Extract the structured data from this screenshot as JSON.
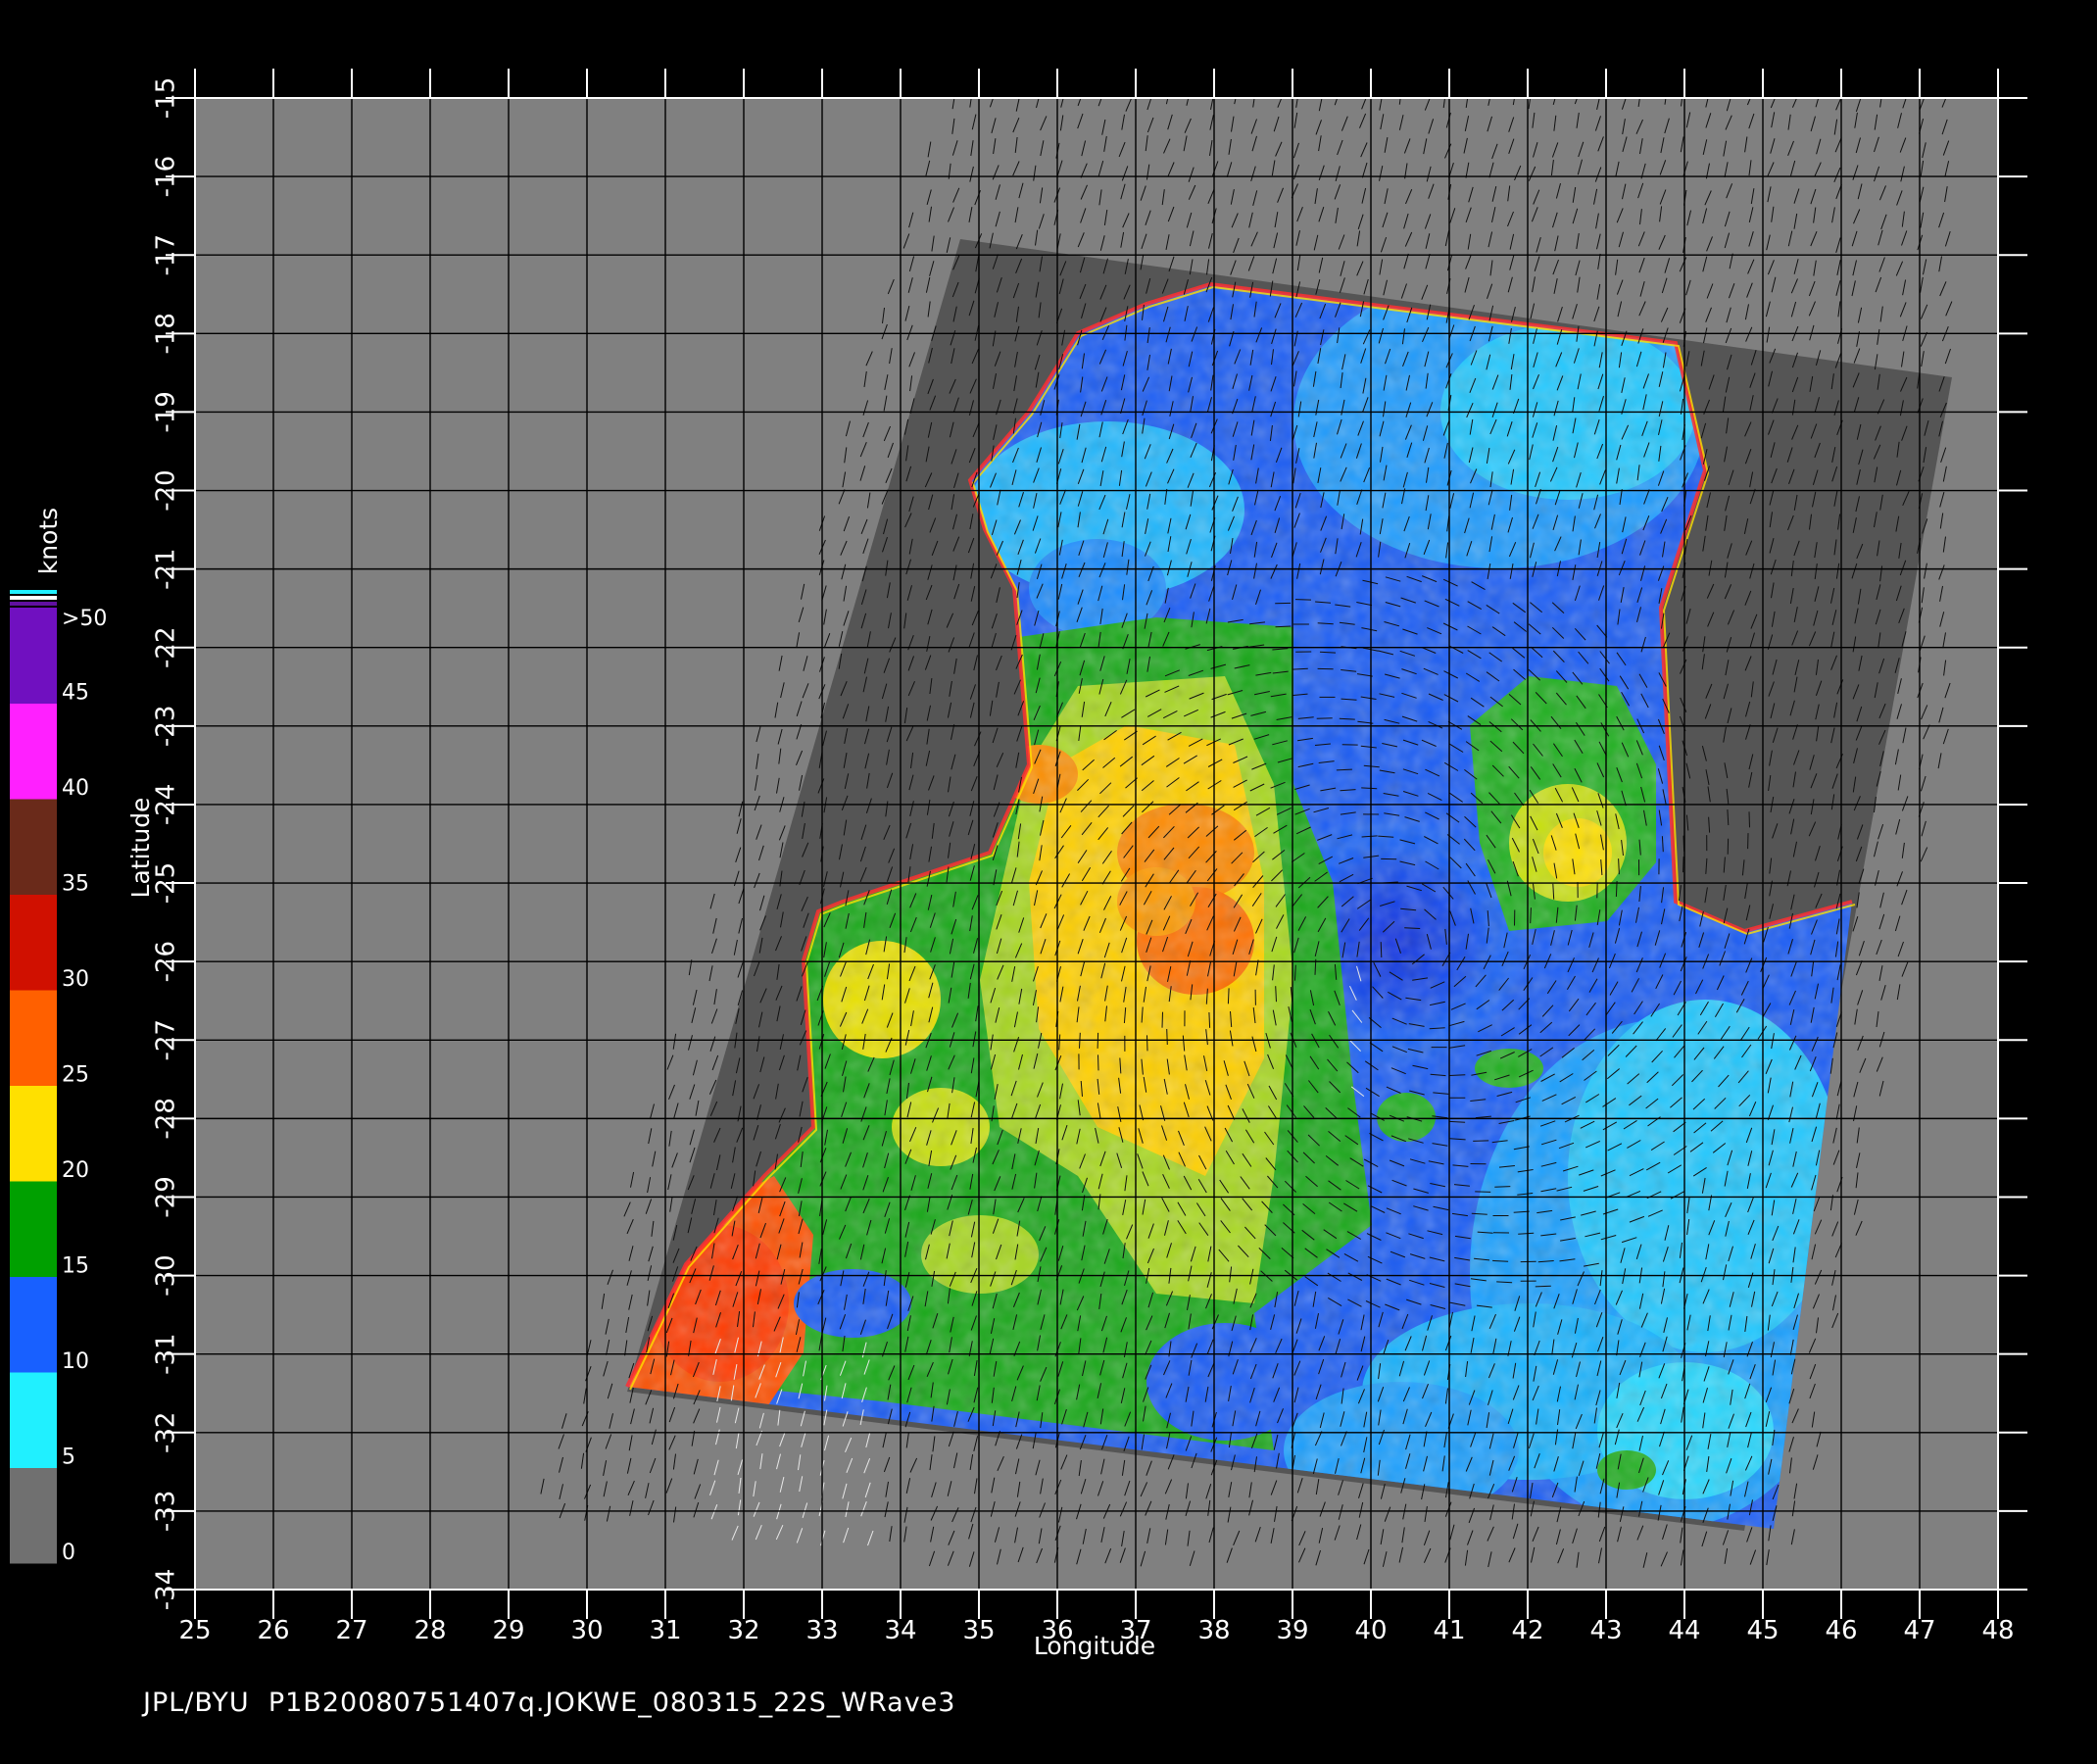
{
  "map": {
    "xlabel": "Longitude",
    "ylabel": "Latitude",
    "lon_range": [
      25,
      48
    ],
    "lat_range": [
      -34,
      -15
    ],
    "lon_ticks": [
      "25",
      "26",
      "27",
      "28",
      "29",
      "30",
      "31",
      "32",
      "33",
      "34",
      "35",
      "36",
      "37",
      "38",
      "39",
      "40",
      "41",
      "42",
      "43",
      "44",
      "45",
      "46",
      "47",
      "48"
    ],
    "lat_ticks": [
      "-15",
      "-16",
      "-17",
      "-18",
      "-19",
      "-20",
      "-21",
      "-22",
      "-23",
      "-24",
      "-25",
      "-26",
      "-27",
      "-28",
      "-29",
      "-30",
      "-31",
      "-32",
      "-33",
      "-34"
    ],
    "grid": true,
    "background_color": "#808080",
    "swath_color": "#555555",
    "storm_center_lon": 40.5,
    "storm_center_lat": -25.8
  },
  "colorbar": {
    "title": "knots",
    "labels": [
      "0",
      "5",
      "10",
      "15",
      "20",
      "25",
      "30",
      "35",
      "40",
      "45",
      ">50"
    ],
    "colors": [
      "#707070",
      "#20f0ff",
      "#1860ff",
      "#00a000",
      "#ffe000",
      "#ff6000",
      "#d01000",
      "#6a2a1a",
      "#ff20ff",
      "#7010c0"
    ]
  },
  "footer_text": "JPL/BYU  P1B20080751407q.JOKWE_080315_22S_WRave3"
}
